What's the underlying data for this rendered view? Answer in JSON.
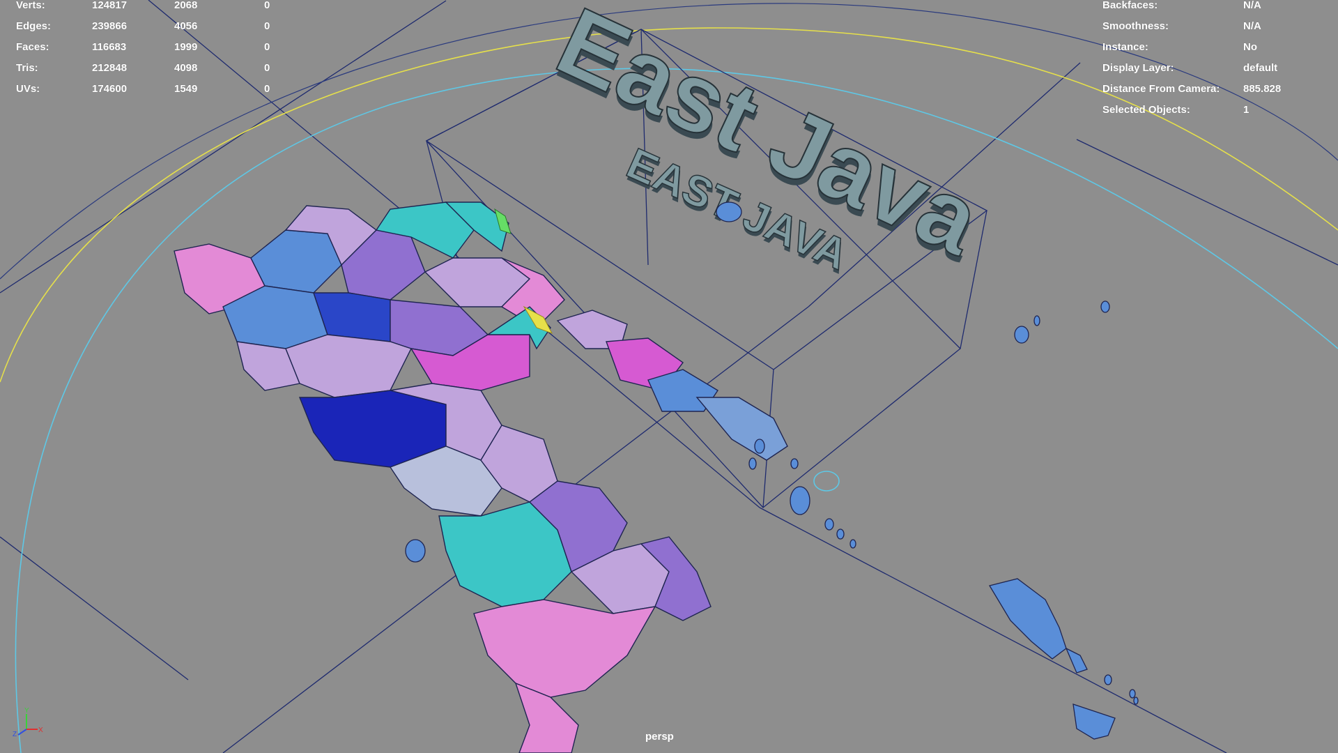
{
  "stats": [
    {
      "label": "Verts:",
      "v1": "124817",
      "v2": "2068",
      "v3": "0"
    },
    {
      "label": "Edges:",
      "v1": "239866",
      "v2": "4056",
      "v3": "0"
    },
    {
      "label": "Faces:",
      "v1": "116683",
      "v2": "1999",
      "v3": "0"
    },
    {
      "label": "Tris:",
      "v1": "212848",
      "v2": "4098",
      "v3": "0"
    },
    {
      "label": "UVs:",
      "v1": "174600",
      "v2": "1549",
      "v3": "0"
    }
  ],
  "object_info": [
    {
      "label": "Backfaces:",
      "value": "N/A"
    },
    {
      "label": "Smoothness:",
      "value": "N/A"
    },
    {
      "label": "Instance:",
      "value": "No"
    },
    {
      "label": "Display Layer:",
      "value": "default"
    },
    {
      "label": "Distance From Camera:",
      "value": "885.828"
    },
    {
      "label": "Selected Objects:",
      "value": "1"
    }
  ],
  "scene": {
    "title_3d_large": "East Java",
    "title_3d_small": "EAST JAVA",
    "camera": "persp",
    "colors": {
      "background": "#8e8e8e",
      "grid_line": "#1e2a6e",
      "yellow_arc": "#e6e04a",
      "cyan_arc": "#5ec8e6",
      "text_face": "#7f9aa0",
      "pink": "#e38ad6",
      "magenta": "#d65ad2",
      "cyan": "#3cc6c6",
      "blue": "#2a46c8",
      "deep_blue": "#1a25b8",
      "lavender": "#c0a4dc",
      "light_blue": "#5a8ed8",
      "violet": "#9070d0"
    }
  },
  "axis_gizmo": {
    "x": "X",
    "y": "Y",
    "z": "Z"
  }
}
